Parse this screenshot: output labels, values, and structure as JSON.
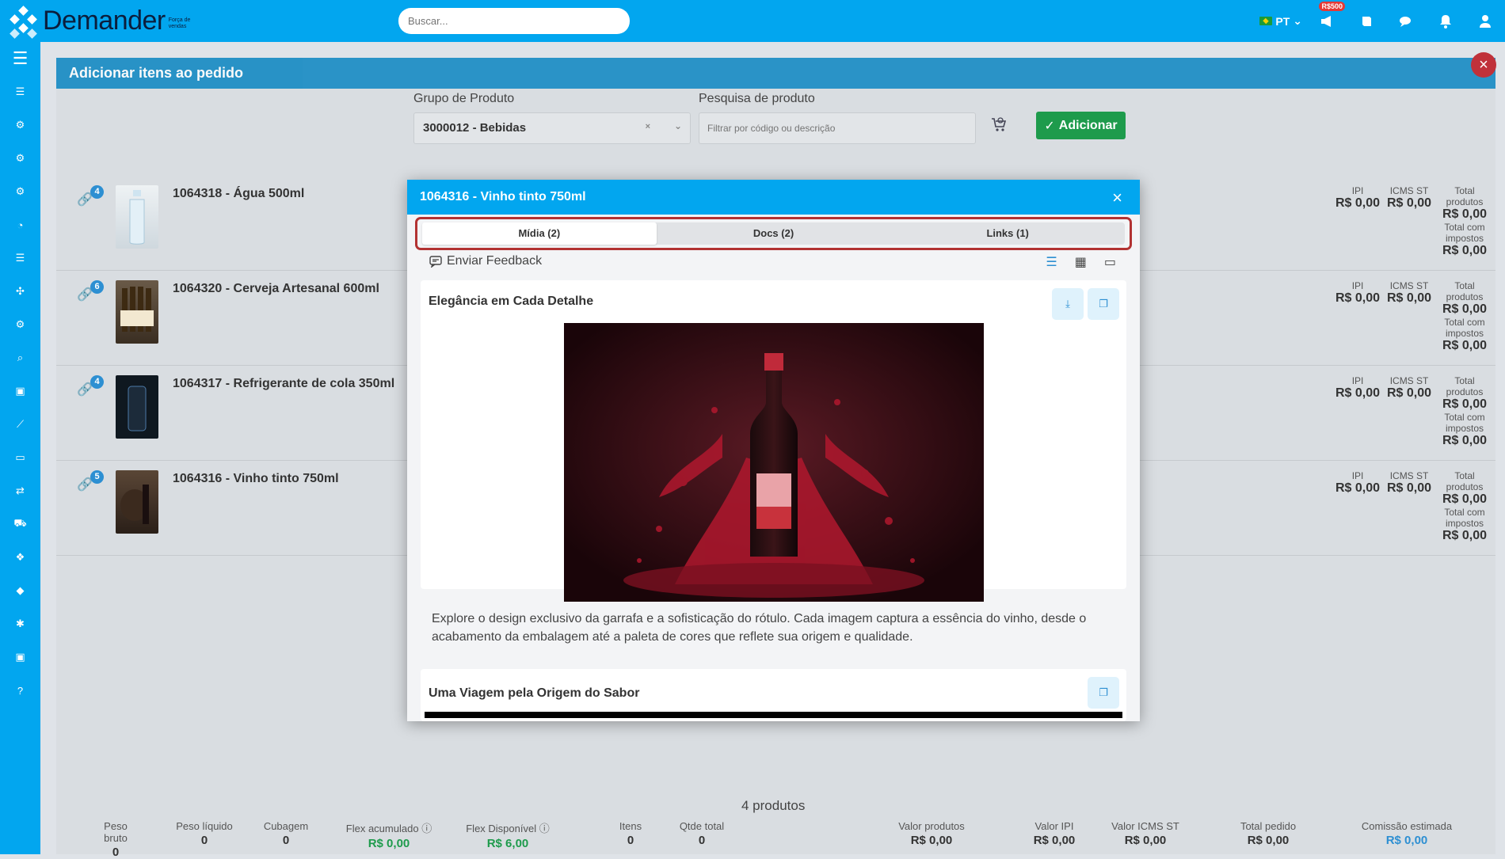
{
  "brand": {
    "name": "Demander",
    "sub": "Força de vendas"
  },
  "search": {
    "placeholder": "Buscar..."
  },
  "top": {
    "lang": "PT",
    "money_badge": "R$500"
  },
  "panel": {
    "title": "Adicionar itens ao pedido"
  },
  "filters": {
    "group_label": "Grupo de Produto",
    "group_value": "3000012 - Bebidas",
    "search_label": "Pesquisa de produto",
    "search_placeholder": "Filtrar por código ou descrição",
    "add_label": "Adicionar"
  },
  "columns": {
    "ipi": "IPI",
    "icms": "ICMS ST",
    "total": "Total produtos",
    "total_tax": "Total com impostos"
  },
  "products": [
    {
      "count": "4",
      "name": "1064318 - Água 500ml",
      "ipi": "R$ 0,00",
      "icms": "R$ 0,00",
      "total": "R$ 0,00",
      "total_tax": "R$ 0,00"
    },
    {
      "count": "6",
      "name": "1064320 - Cerveja Artesanal 600ml",
      "ipi": "R$ 0,00",
      "icms": "R$ 0,00",
      "total": "R$ 0,00",
      "total_tax": "R$ 0,00"
    },
    {
      "count": "4",
      "name": "1064317 - Refrigerante de cola 350ml",
      "ipi": "R$ 0,00",
      "icms": "R$ 0,00",
      "total": "R$ 0,00",
      "total_tax": "R$ 0,00"
    },
    {
      "count": "5",
      "name": "1064316 - Vinho tinto 750ml",
      "ipi": "R$ 0,00",
      "icms": "R$ 0,00",
      "total": "R$ 0,00",
      "total_tax": "R$ 0,00"
    }
  ],
  "footer": {
    "count": "4 produtos",
    "peso_bruto": {
      "label": "Peso bruto",
      "value": "0"
    },
    "peso_liquido": {
      "label": "Peso líquido",
      "value": "0"
    },
    "cubagem": {
      "label": "Cubagem",
      "value": "0"
    },
    "flex_acum": {
      "label": "Flex acumulado",
      "value": "R$ 0,00"
    },
    "flex_disp": {
      "label": "Flex Disponível",
      "value": "R$ 6,00"
    },
    "itens": {
      "label": "Itens",
      "value": "0"
    },
    "qtde": {
      "label": "Qtde total",
      "value": "0"
    },
    "valor_prod": {
      "label": "Valor produtos",
      "value": "R$ 0,00"
    },
    "valor_ipi": {
      "label": "Valor IPI",
      "value": "R$ 0,00"
    },
    "valor_icms": {
      "label": "Valor ICMS ST",
      "value": "R$ 0,00"
    },
    "total_pedido": {
      "label": "Total pedido",
      "value": "R$ 0,00"
    },
    "comissao": {
      "label": "Comissão estimada",
      "value": "R$ 0,00"
    }
  },
  "modal": {
    "title": "1064316 - Vinho tinto 750ml",
    "tabs": [
      "Mídia (2)",
      "Docs (2)",
      "Links (1)"
    ],
    "feedback": "Enviar Feedback",
    "card1": {
      "title": "Elegância em Cada Detalhe",
      "description": "Explore o design exclusivo da garrafa e a sofisticação do rótulo. Cada imagem captura a essência do vinho, desde o acabamento da embalagem até a paleta de cores que reflete sua origem e qualidade."
    },
    "card2": {
      "title": "Uma Viagem pela Origem do Sabor"
    }
  },
  "colors": {
    "primary": "#02a6ef",
    "success": "#1e9b4c",
    "danger": "#c0313a"
  }
}
